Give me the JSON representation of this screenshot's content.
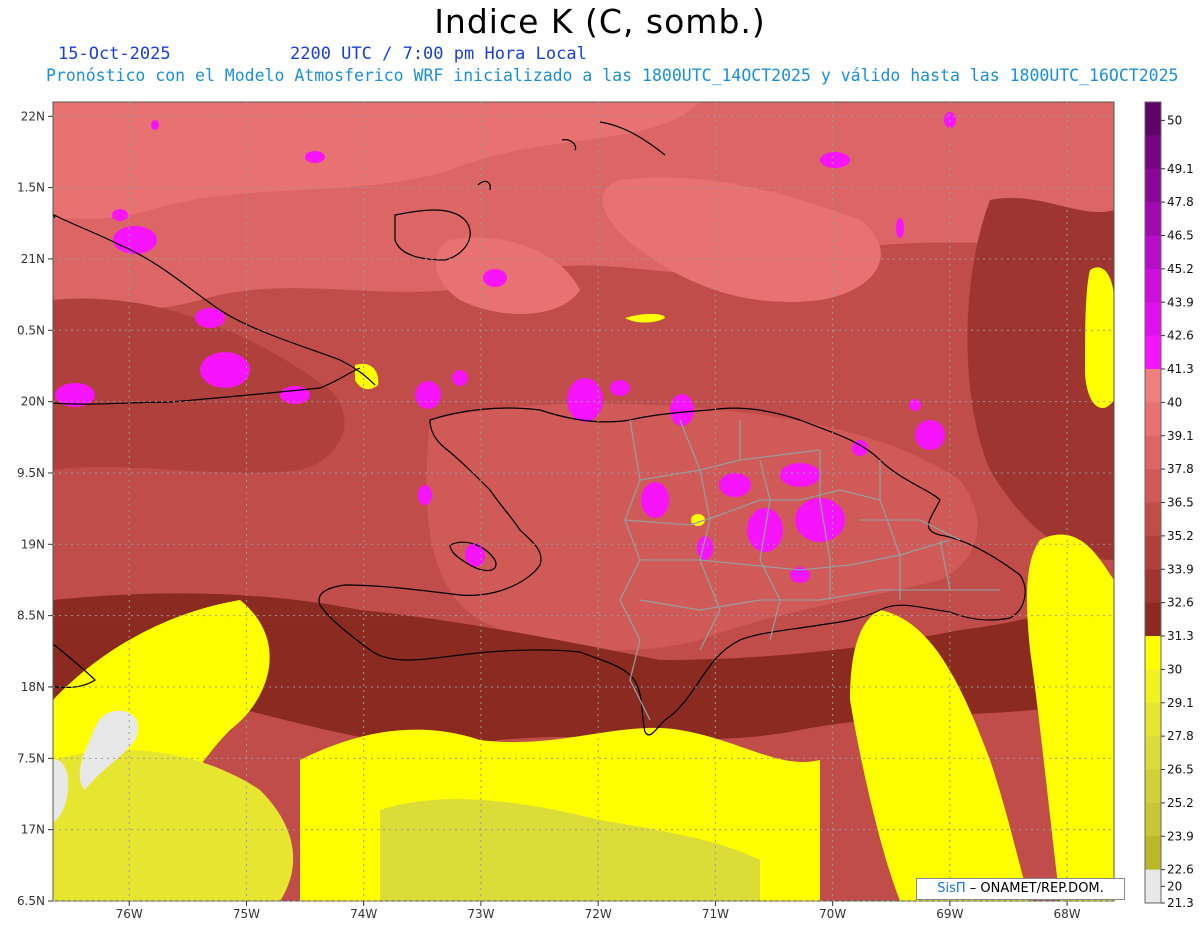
{
  "header": {
    "title": "Indice K (C, somb.)",
    "date": "15-Oct-2025",
    "valid_time": "2200 UTC / 7:00 pm Hora Local",
    "description": "Pronóstico con el Modelo Atmosferico WRF inicializado a las 1800UTC_14OCT2025 y válido hasta las  1800UTC_16OCT2025"
  },
  "map": {
    "lat_range": [
      16.5,
      22.1
    ],
    "lon_range": [
      -76.65,
      -67.6
    ],
    "lat_ticks": [
      "22N",
      "1.5N",
      "21N",
      "0.5N",
      "20N",
      "9.5N",
      "19N",
      "8.5N",
      "18N",
      "7.5N",
      "17N",
      "6.5N"
    ],
    "lon_ticks": [
      "76W",
      "75W",
      "74W",
      "73W",
      "72W",
      "71W",
      "70W",
      "69W",
      "68W"
    ]
  },
  "legend": {
    "levels": [
      "50",
      "49.1",
      "47.8",
      "46.5",
      "45.2",
      "43.9",
      "42.6",
      "41.3",
      "40",
      "39.1",
      "37.8",
      "36.5",
      "35.2",
      "33.9",
      "32.6",
      "31.3",
      "30",
      "29.1",
      "27.8",
      "26.5",
      "25.2",
      "23.9",
      "22.6",
      "21.3",
      "20"
    ],
    "colors": [
      "#5e0466",
      "#74067f",
      "#8a0898",
      "#a00ab0",
      "#b70cc8",
      "#cc0fdc",
      "#e010ec",
      "#f514fb",
      "#ef7e7e",
      "#e87272",
      "#dc6666",
      "#cf5a58",
      "#c04d4a",
      "#b0403c",
      "#9f3530",
      "#8b2a20",
      "#ffff00",
      "#f2f220",
      "#e6e630",
      "#dcdc38",
      "#d0d038",
      "#c6c636",
      "#b8b82a",
      "#e8e8e8"
    ]
  },
  "credit": {
    "brand": "SisΠ",
    "text": " – ONAMET/REP.DOM."
  }
}
